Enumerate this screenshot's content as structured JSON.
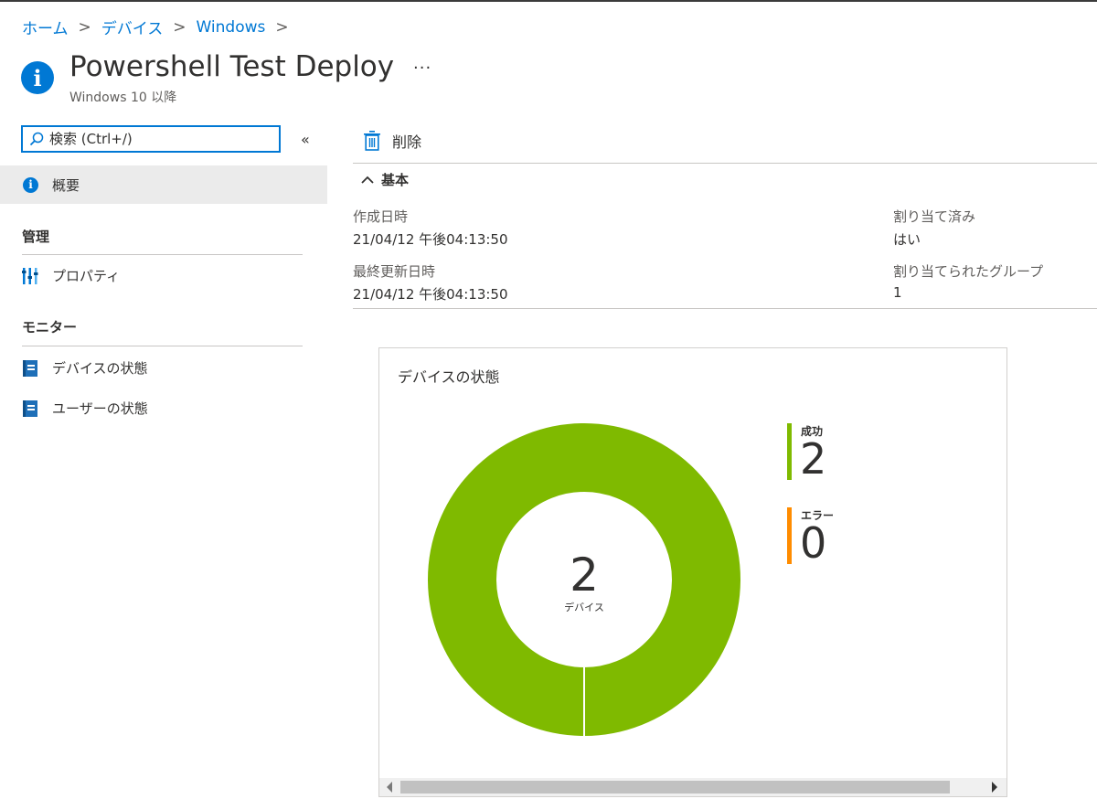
{
  "breadcrumb": [
    {
      "label": "ホーム"
    },
    {
      "label": "デバイス"
    },
    {
      "label": "Windows"
    }
  ],
  "header": {
    "title": "Powershell Test Deploy",
    "subtitle": "Windows 10 以降",
    "more": "···"
  },
  "search": {
    "placeholder": "検索 (Ctrl+/)"
  },
  "nav": {
    "collapse": "«",
    "overview": "概要",
    "sections": [
      {
        "title": "管理",
        "items": [
          {
            "label": "プロパティ",
            "icon": "properties-icon"
          }
        ]
      },
      {
        "title": "モニター",
        "items": [
          {
            "label": "デバイスの状態",
            "icon": "report-icon"
          },
          {
            "label": "ユーザーの状態",
            "icon": "report-icon"
          }
        ]
      }
    ]
  },
  "toolbar": {
    "delete_label": "削除"
  },
  "essentials": {
    "title": "基本",
    "created_label": "作成日時",
    "created_value": "21/04/12 午後04:13:50",
    "modified_label": "最終更新日時",
    "modified_value": "21/04/12 午後04:13:50",
    "assigned_label": "割り当て済み",
    "assigned_value": "はい",
    "groups_label": "割り当てられたグループ",
    "groups_value": "1"
  },
  "chart_data": {
    "type": "pie",
    "title": "デバイスの状態",
    "center_value": "2",
    "center_label": "デバイス",
    "categories": [
      "成功",
      "エラー"
    ],
    "values": [
      2,
      0
    ],
    "colors": [
      "#7fba00",
      "#ff8c00"
    ]
  },
  "colors": {
    "accent": "#0078d4",
    "success": "#7fba00",
    "error": "#ff8c00"
  }
}
